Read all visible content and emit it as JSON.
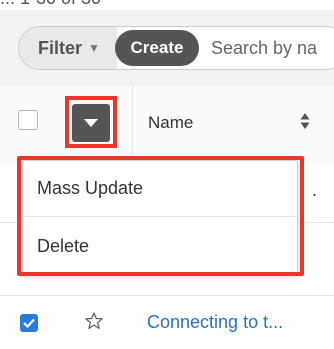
{
  "top_partial_text": "...  1-30 of 30",
  "filter_bar": {
    "filter_label": "Filter",
    "create_label": "Create",
    "search_placeholder": "Search by na"
  },
  "list_header": {
    "name_label": "Name"
  },
  "action_menu": {
    "items": [
      {
        "label": "Mass Update"
      },
      {
        "label": "Delete"
      }
    ]
  },
  "rows": [
    {
      "checked": true,
      "starred": false,
      "name": "Connecting to t..."
    }
  ],
  "colors": {
    "highlight": "#e6372a",
    "link": "#2870c6",
    "checkbox_checked": "#2b7bd8",
    "dark_button": "#555555"
  }
}
